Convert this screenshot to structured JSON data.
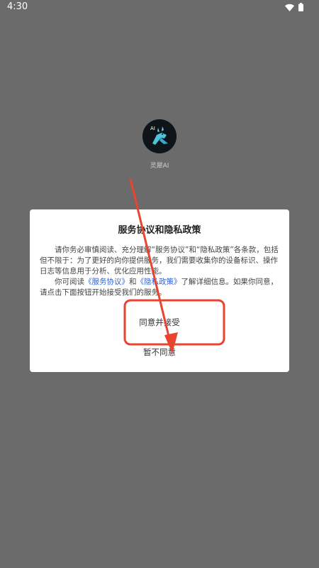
{
  "status_bar": {
    "time": "4:30"
  },
  "app": {
    "name": "灵犀AI",
    "logo_text": "AI"
  },
  "dialog": {
    "title": "服务协议和隐私政策",
    "paragraph1": "请你务必审慎阅读、充分理解“服务协议”和“隐私政策”各条款，包括但不限于：为了更好的向你提供服务，我们需要收集你的设备标识、操作日志等信息用于分析、优化应用性能。",
    "paragraph2_prefix": "你可阅读",
    "link_service": "《服务协议》",
    "paragraph2_and": "和",
    "link_privacy": "《隐私政策》",
    "paragraph2_suffix": "了解详细信息。如果你同意，请点击下面按钮开始接受我们的服务。",
    "accept_label": "同意并接受",
    "decline_label": "暂不同意"
  },
  "annotation": {
    "color": "#e8442f"
  }
}
